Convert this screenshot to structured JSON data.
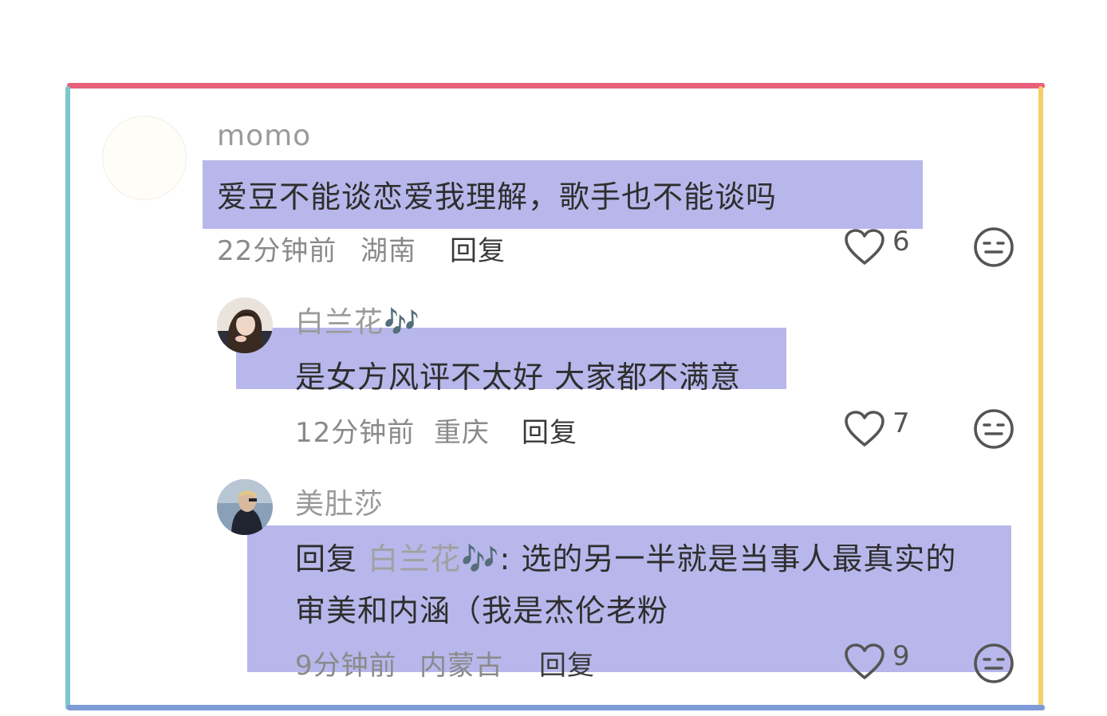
{
  "comments": [
    {
      "username": "momo",
      "content": "爱豆不能谈恋爱我理解，歌手也不能谈吗",
      "time": "22分钟前",
      "location": "湖南",
      "reply_label": "回复",
      "likes": "6"
    },
    {
      "username": "白兰花🎶",
      "content": "是女方风评不太好 大家都不满意",
      "time": "12分钟前",
      "location": "重庆",
      "reply_label": "回复",
      "likes": "7"
    },
    {
      "username": "美肚莎",
      "reply_prefix": "回复",
      "reply_to": "白兰花🎶",
      "content_line1": ": 选的另一半就是当事人最真实的",
      "content_line2": "审美和内涵（我是杰伦老粉",
      "time": "9分钟前",
      "location": "内蒙古",
      "reply_label": "回复",
      "likes": "9"
    }
  ],
  "colors": {
    "highlight": "#8c8ade",
    "border_top": "#e8607a",
    "border_left": "#7cc8cc",
    "border_right": "#f5cf6a",
    "border_bottom": "#7d9bd6"
  },
  "icons": {
    "like": "heart-outline-icon",
    "dislike": "neutral-face-icon"
  }
}
